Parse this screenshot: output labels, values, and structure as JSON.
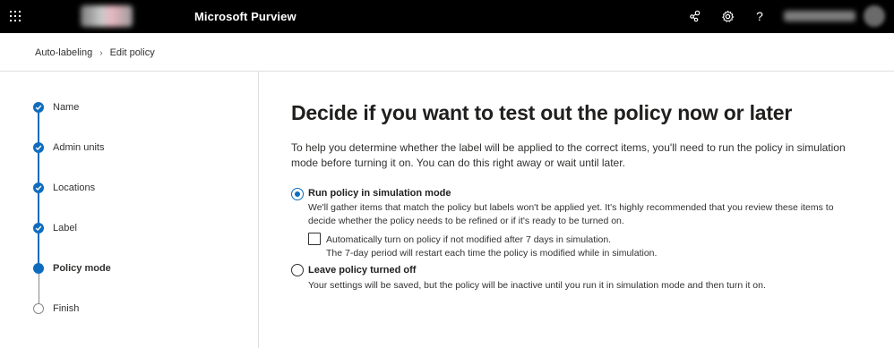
{
  "topbar": {
    "app_title": "Microsoft Purview",
    "icons": [
      "waffle-icon",
      "share-icon",
      "gear-icon",
      "help-icon"
    ],
    "help_glyph": "?"
  },
  "breadcrumb": {
    "items": [
      "Auto-labeling",
      "Edit policy"
    ],
    "separator": "›"
  },
  "steps": [
    {
      "label": "Name",
      "state": "completed"
    },
    {
      "label": "Admin units",
      "state": "completed"
    },
    {
      "label": "Locations",
      "state": "completed"
    },
    {
      "label": "Label",
      "state": "completed"
    },
    {
      "label": "Policy mode",
      "state": "current"
    },
    {
      "label": "Finish",
      "state": "pending"
    }
  ],
  "main": {
    "title": "Decide if you want to test out the policy now or later",
    "description": "To help you determine whether the label will be applied to the correct items, you'll need to run the policy in simulation mode before turning it on. You can do this right away or wait until later.",
    "options": [
      {
        "title": "Run policy in simulation mode",
        "description": "We'll gather items that match the policy but labels won't be applied yet. It's highly recommended that you review these items to decide whether the policy needs to be refined or if it's ready to be turned on.",
        "selected": true,
        "checkbox": {
          "label": "Automatically turn on policy if not modified after 7 days in simulation.",
          "sublabel": "The 7-day period will restart each time the policy is modified while in simulation.",
          "checked": false
        }
      },
      {
        "title": "Leave policy turned off",
        "description": "Your settings will be saved, but the policy will be inactive until you run it in simulation mode and then turn it on.",
        "selected": false
      }
    ]
  },
  "colors": {
    "accent": "#0f6cbd",
    "topbar_bg": "#000000",
    "text": "#323130"
  }
}
